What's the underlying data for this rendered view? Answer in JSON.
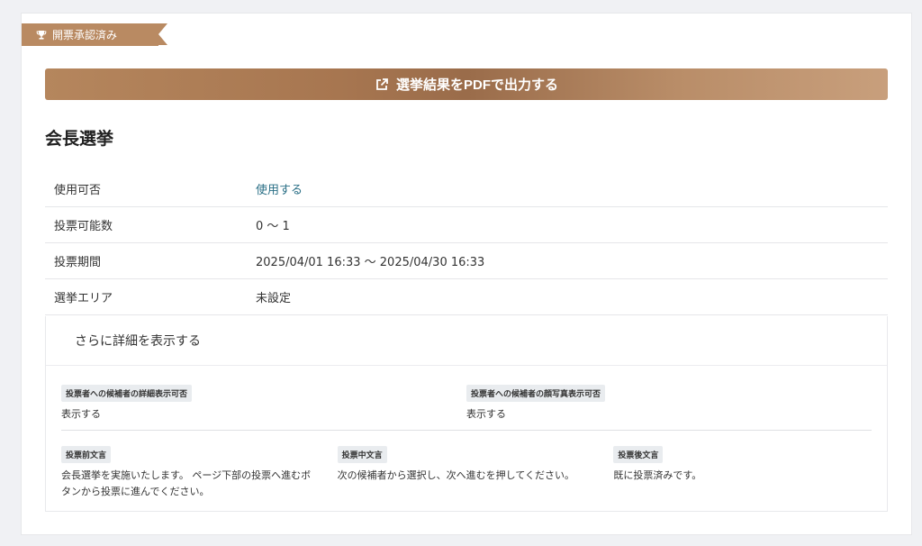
{
  "ribbon": {
    "label": "開票承認済み",
    "icon": "trophy-icon"
  },
  "pdf_button": {
    "label": "選挙結果をPDFで出力する",
    "icon": "external-link-icon"
  },
  "election": {
    "title": "会長選挙"
  },
  "info_rows": [
    {
      "label": "使用可否",
      "value": "使用する"
    },
    {
      "label": "投票可能数",
      "value": "0 〜 1"
    },
    {
      "label": "投票期間",
      "value": "2025/04/01 16:33 〜 2025/04/30 16:33"
    },
    {
      "label": "選挙エリア",
      "value": "未設定"
    }
  ],
  "details": {
    "heading": "さらに詳細を表示する",
    "candidate_detail": {
      "label": "投票者への候補者の詳細表示可否",
      "value": "表示する"
    },
    "candidate_photo": {
      "label": "投票者への候補者の顔写真表示可否",
      "value": "表示する"
    },
    "pre_vote": {
      "label": "投票前文言",
      "value_line1": "会長選挙を実施いたします。 ページ下部の投票へ進むボ",
      "value_line2": "タンから投票に進んでください。"
    },
    "during_vote": {
      "label": "投票中文言",
      "value": "次の候補者から選択し、次へ進むを押してください。"
    },
    "post_vote": {
      "label": "投票後文言",
      "value": "既に投票済みです。"
    }
  },
  "colors": {
    "accent": "#b98a62",
    "link": "#2a6f86",
    "background": "#f0f1f4"
  }
}
